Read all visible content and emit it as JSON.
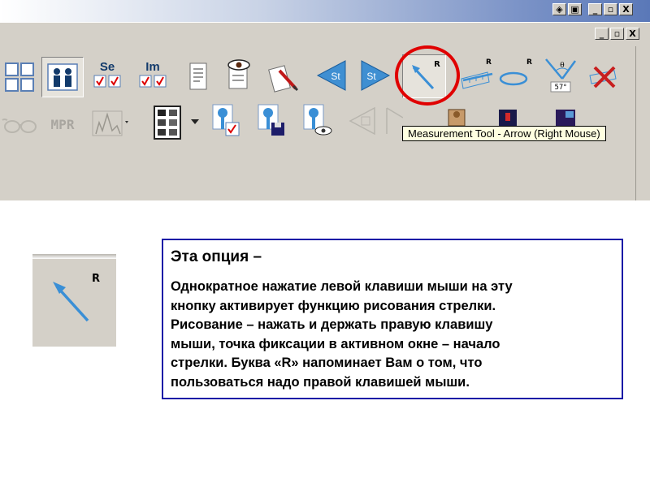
{
  "window": {
    "top_buttons": [
      "◈",
      "▣",
      "_",
      "▫",
      "X"
    ],
    "doc_buttons": [
      "_",
      "▫",
      "X"
    ]
  },
  "toolbar": {
    "row1": [
      {
        "name": "layout-2x2-icon"
      },
      {
        "name": "patient-layout-icon"
      },
      {
        "name": "series-icon",
        "label": "Se"
      },
      {
        "name": "image-icon",
        "label": "Im"
      },
      {
        "name": "document-icon"
      },
      {
        "name": "view-eye-icon"
      },
      {
        "name": "annotate-pen-icon"
      },
      {
        "name": "previous-study-icon",
        "label": "St"
      },
      {
        "name": "next-study-icon",
        "label": "St"
      },
      {
        "name": "measurement-arrow-icon",
        "badge": "R"
      },
      {
        "name": "ruler-icon",
        "badge": "R"
      },
      {
        "name": "ellipse-icon",
        "badge": "R"
      },
      {
        "name": "angle-icon",
        "value": "57°"
      },
      {
        "name": "delete-measurements-icon"
      }
    ],
    "row2": [
      {
        "name": "glasses-icon"
      },
      {
        "name": "mpr-icon",
        "label": "MPR"
      },
      {
        "name": "histogram-icon"
      },
      {
        "name": "film-layout-icon"
      },
      {
        "name": "key-check-icon"
      },
      {
        "name": "key-save-icon"
      },
      {
        "name": "key-view-icon"
      },
      {
        "name": "previous-disabled-icon"
      },
      {
        "name": "next-disabled-icon"
      }
    ],
    "tooltip": "Measurement Tool - Arrow (Right Mouse)"
  },
  "zoom_icon": {
    "badge": "R"
  },
  "info": {
    "title": "Эта опция –",
    "body": "Однократное нажатие левой клавиши мыши на эту\nкнопку  активирует функцию рисования  стрелки.\nРисование – нажать и держать правую клавишу\nмыши, точка фиксации в активном окне – начало\nстрелки. Буква «R» напоминает Вам о том, что\nпользоваться надо правой клавишей мыши."
  },
  "colors": {
    "toolbar_bg": "#d4d0c8",
    "highlight_circle": "#e00000",
    "info_border": "#1a1aa6",
    "icon_blue": "#3a8fd6"
  }
}
